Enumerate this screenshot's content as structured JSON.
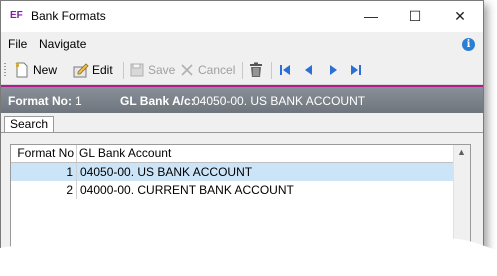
{
  "window": {
    "app_icon": "EF",
    "title": "Bank Formats",
    "minimize_glyph": "—",
    "maximize_glyph": "☐",
    "close_glyph": "✕"
  },
  "menu": {
    "file": "File",
    "navigate": "Navigate",
    "info_glyph": "i"
  },
  "toolbar": {
    "new_label": "New",
    "edit_label": "Edit",
    "save_label": "Save",
    "cancel_label": "Cancel",
    "delete_icon": "trash-icon",
    "first_glyph": "⏮",
    "prev_glyph": "◀",
    "next_glyph": "▶",
    "last_glyph": "⏭"
  },
  "header": {
    "format_no_label": "Format No:",
    "format_no_value": "1",
    "gl_label": "GL Bank A/c:",
    "gl_value": "04050-00. US BANK ACCOUNT"
  },
  "tabs": {
    "search": "Search"
  },
  "grid": {
    "columns": [
      "Format No",
      "GL Bank Account"
    ],
    "rows": [
      {
        "format_no": "1",
        "account": "04050-00. US BANK ACCOUNT",
        "selected": true
      },
      {
        "format_no": "2",
        "account": "04000-00. CURRENT BANK ACCOUNT",
        "selected": false
      }
    ],
    "scroll_up_glyph": "▲"
  },
  "colors": {
    "accent_magenta": "#b21b8e",
    "header_band": "#7b8088",
    "selection": "#cce4f7",
    "nav_blue": "#2a6fd6"
  }
}
